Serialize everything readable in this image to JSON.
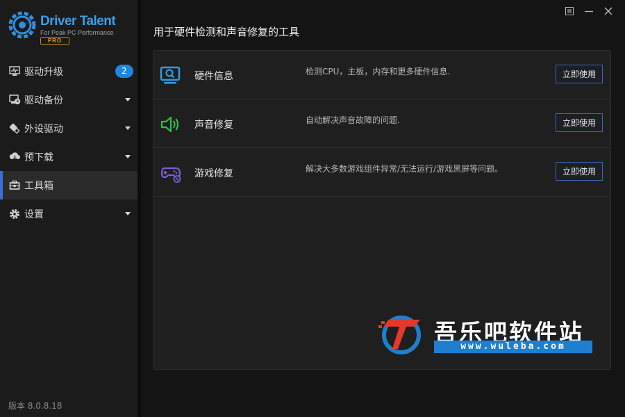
{
  "app": {
    "logo_text": "Driver Talent",
    "logo_sub": "For Peak PC Performance",
    "logo_badge": "PRO",
    "brand_color": "#3aa0ea"
  },
  "sidebar": {
    "items": [
      {
        "label": "驱动升级",
        "badge": "2",
        "icon": "monitor-wave-icon"
      },
      {
        "label": "驱动备份",
        "icon": "backup-clock-icon"
      },
      {
        "label": "外设驱动",
        "icon": "usb-device-icon"
      },
      {
        "label": "预下载",
        "icon": "cloud-download-icon"
      },
      {
        "label": "工具箱",
        "icon": "toolbox-icon",
        "active": true
      },
      {
        "label": "设置",
        "icon": "gear-icon"
      }
    ],
    "version": "版本 8.0.8.18"
  },
  "main": {
    "title": "用于硬件检测和声音修复的工具",
    "tools": [
      {
        "name": "硬件信息",
        "desc": "检测CPU，主板，内存和更多硬件信息.",
        "button": "立即使用",
        "icon": "monitor-search-icon",
        "icon_color": "#2e9be6"
      },
      {
        "name": "声音修复",
        "desc": "自动解决声音故障的问题.",
        "button": "立即使用",
        "icon": "speaker-icon",
        "icon_color": "#2fbf47"
      },
      {
        "name": "游戏修复",
        "desc": "解决大多数游戏组件异常/无法运行/游戏黑屏等问题。",
        "button": "立即使用",
        "icon": "gamepad-wrench-icon",
        "icon_color": "#7b5fd6"
      }
    ]
  },
  "watermark": {
    "text": "吾乐吧软件站",
    "url": "www.wuleba.com"
  }
}
